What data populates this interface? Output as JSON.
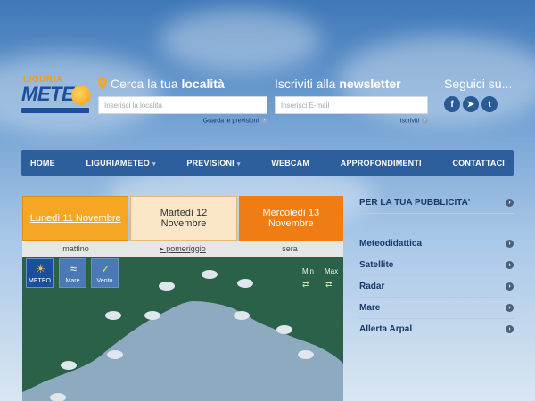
{
  "logo": {
    "top_text": "LIGURIA",
    "main_text": "METEO"
  },
  "search": {
    "title_prefix": "Cerca la tua ",
    "title_bold": "località",
    "placeholder": "Inserisci la località",
    "link": "Guarda le previsioni"
  },
  "newsletter": {
    "title_prefix": "Iscriviti alla ",
    "title_bold": "newsletter",
    "placeholder": "Inserisci E-mail",
    "link": "Iscriviti"
  },
  "social": {
    "title": "Seguici su...",
    "icons": [
      "facebook-icon",
      "telegram-icon",
      "twitter-icon"
    ]
  },
  "nav": {
    "items": [
      "HOME",
      "LIGURIAMETEO",
      "PREVISIONI",
      "WEBCAM",
      "APPROFONDIMENTI",
      "CONTATTACI"
    ]
  },
  "days": [
    "Lunedì 11 Novembre",
    "Martedì 12 Novembre",
    "Mercoledì 13 Novembre"
  ],
  "periods": [
    "mattino",
    "pomeriggio",
    "sera"
  ],
  "map_buttons": {
    "meteo": "METEO",
    "mare": "Mare",
    "vento": "Vento",
    "min": "Min",
    "max": "Max"
  },
  "right_panel": {
    "ad": "PER LA TUA PUBBLICITA'",
    "links": [
      "Meteodidattica",
      "Satellite",
      "Radar",
      "Mare",
      "Allerta Arpal"
    ]
  },
  "colors": {
    "nav_bg": "#2c5f9c",
    "accent_orange": "#f5a623",
    "brand_blue": "#1b4f9b"
  }
}
